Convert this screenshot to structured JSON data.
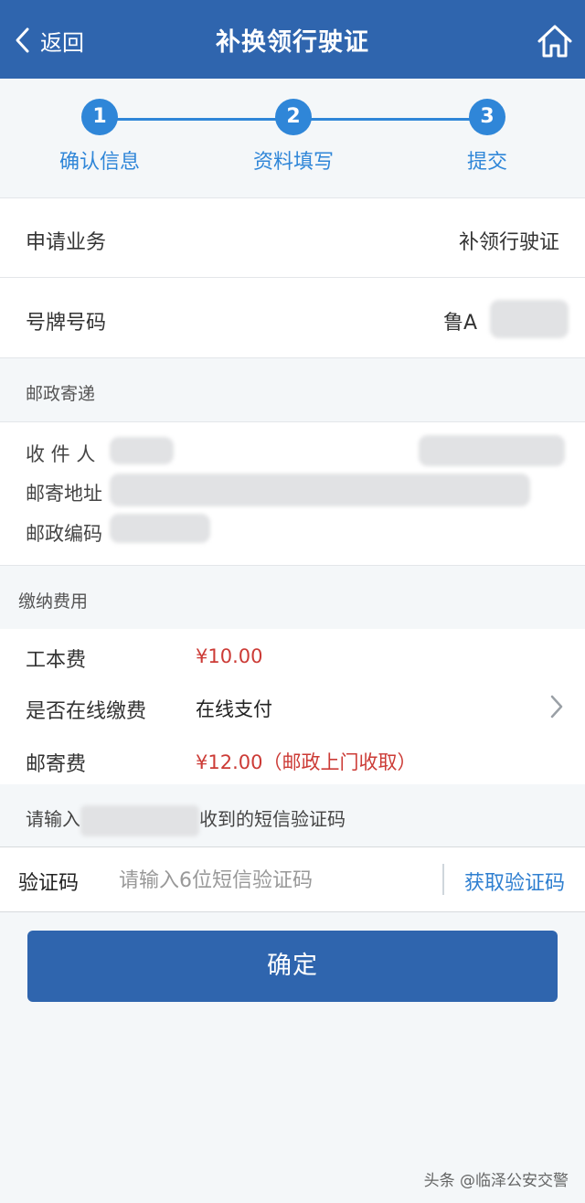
{
  "header": {
    "back_label": "返回",
    "title": "补换领行驶证"
  },
  "steps": [
    {
      "number": "1",
      "label": "确认信息"
    },
    {
      "number": "2",
      "label": "资料填写"
    },
    {
      "number": "3",
      "label": "提交"
    }
  ],
  "application": {
    "business_label": "申请业务",
    "business_value": "补领行驶证",
    "plate_label": "号牌号码",
    "plate_value": "鲁A"
  },
  "postal": {
    "section_title": "邮政寄递",
    "recipient_label": "收 件 人",
    "address_label": "邮寄地址",
    "postcode_label": "邮政编码"
  },
  "fees": {
    "section_title": "缴纳费用",
    "cost_label": "工本费",
    "cost_value": "¥10.00",
    "online_label": "是否在线缴费",
    "online_value": "在线支付",
    "shipping_label": "邮寄费",
    "shipping_value": "¥12.00（邮政上门收取）"
  },
  "verification": {
    "hint_prefix": "请输入",
    "hint_suffix": "收到的短信验证码",
    "code_label": "验证码",
    "code_placeholder": "请输入6位短信验证码",
    "get_code_label": "获取验证码"
  },
  "confirm_label": "确定",
  "watermark": "头条 @临泽公安交警",
  "colors": {
    "header_bg": "#2f65ae",
    "step_blue": "#2f86d8",
    "fee_red": "#cc3b36"
  }
}
